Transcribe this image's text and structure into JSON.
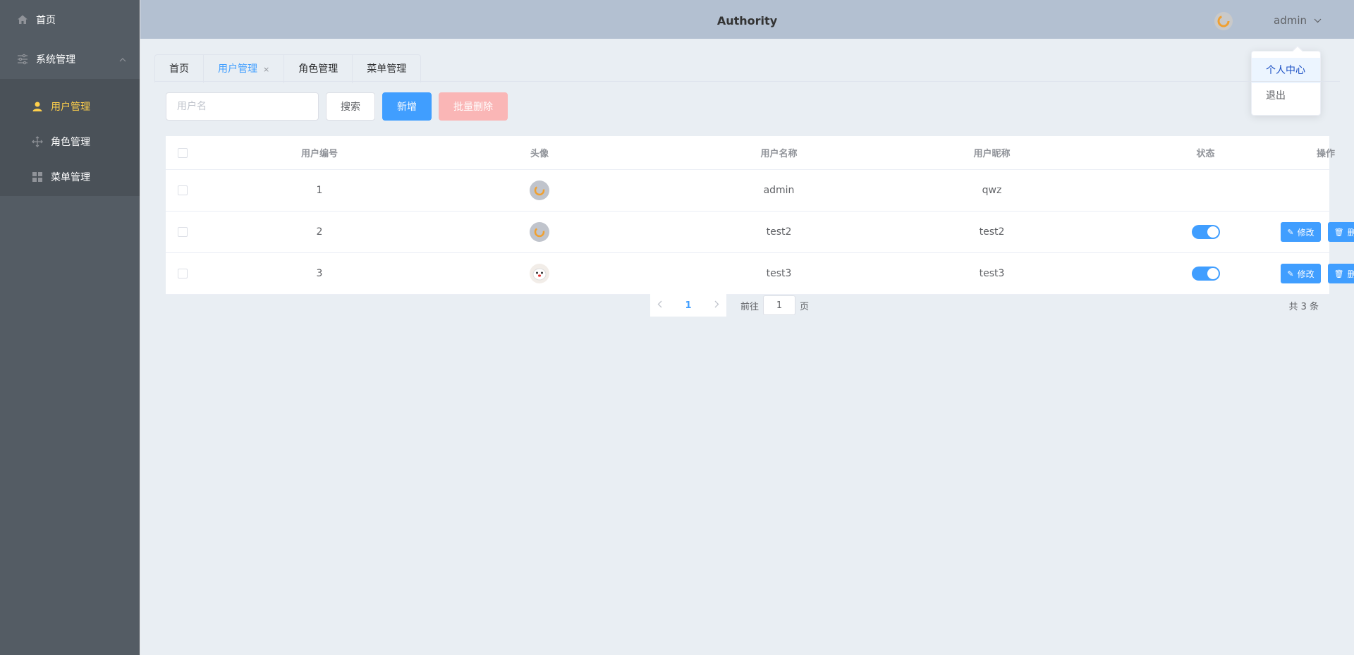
{
  "header": {
    "title": "Authority",
    "username": "admin"
  },
  "dropdown": {
    "items": [
      "个人中心",
      "退出"
    ]
  },
  "sidebar": {
    "home": "首页",
    "system": "系统管理",
    "items": [
      {
        "label": "用户管理",
        "icon": "user-icon",
        "active": true
      },
      {
        "label": "角色管理",
        "icon": "move-icon",
        "active": false
      },
      {
        "label": "菜单管理",
        "icon": "grid-icon",
        "active": false
      }
    ]
  },
  "tabs": [
    {
      "label": "首页"
    },
    {
      "label": "用户管理",
      "active": true,
      "close": "×"
    },
    {
      "label": "角色管理"
    },
    {
      "label": "菜单管理"
    }
  ],
  "toolbar": {
    "search_placeholder": "用户名",
    "search_label": "搜索",
    "add_label": "新增",
    "batch_delete_label": "批量删除"
  },
  "table": {
    "columns": [
      "用户编号",
      "头像",
      "用户名称",
      "用户昵称",
      "状态",
      "操作"
    ],
    "edit_label": "修改",
    "delete_label": "删除",
    "rows": [
      {
        "id": "1",
        "name": "admin",
        "nickname": "qwz",
        "status": null,
        "avatar": "orange-loader-avatar"
      },
      {
        "id": "2",
        "name": "test2",
        "nickname": "test2",
        "status": true,
        "avatar": "orange-loader-avatar"
      },
      {
        "id": "3",
        "name": "test3",
        "nickname": "test3",
        "status": true,
        "avatar": "cat-avatar"
      }
    ]
  },
  "pagination": {
    "current": "1",
    "goto_prefix": "前往",
    "goto_value": "1",
    "goto_suffix": "页",
    "total": "共 3 条"
  },
  "colors": {
    "sidebar": "#545c64",
    "active": "#ffd04b",
    "primary": "#409eff",
    "header": "#b3c0d1",
    "danger_disabled": "#fab6b6"
  }
}
